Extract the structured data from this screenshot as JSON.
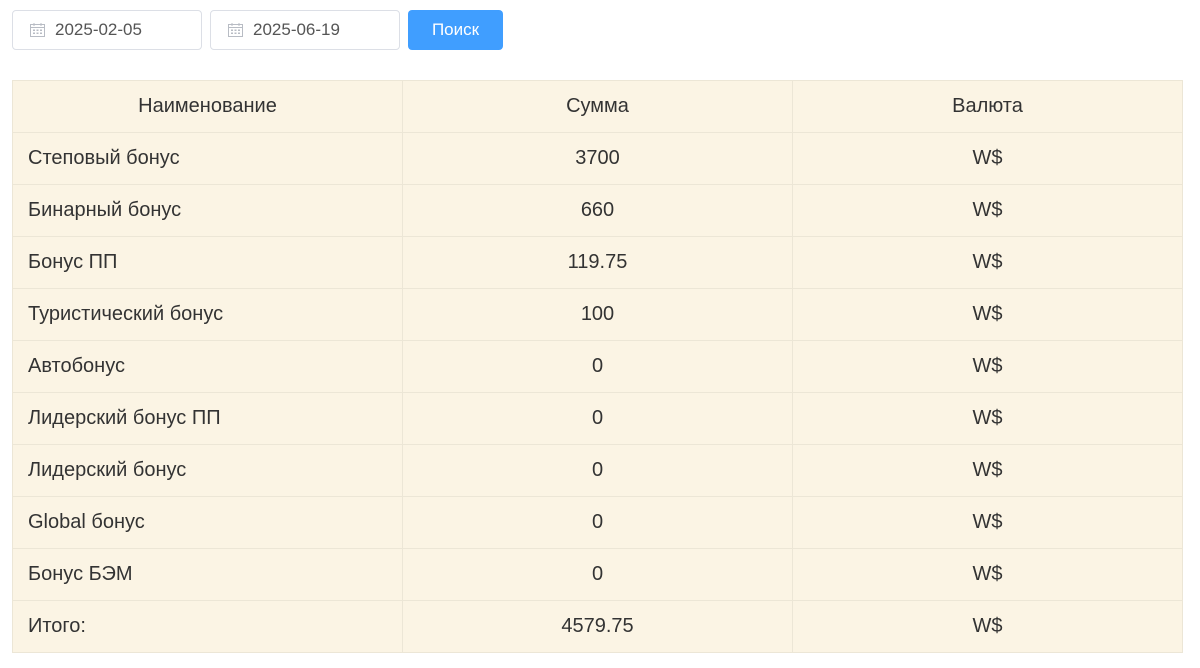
{
  "filters": {
    "date_from": "2025-02-05",
    "date_to": "2025-06-19",
    "date_icon": "calendar-icon",
    "search_label": "Поиск"
  },
  "colors": {
    "accent": "#409eff",
    "table_bg": "#fbf4e4",
    "border": "#ece6d6"
  },
  "table": {
    "headers": {
      "name": "Наименование",
      "amount": "Сумма",
      "currency": "Валюта"
    },
    "rows": [
      {
        "name": "Степовый бонус",
        "amount": "3700",
        "currency": "W$"
      },
      {
        "name": "Бинарный бонус",
        "amount": "660",
        "currency": "W$"
      },
      {
        "name": "Бонус ПП",
        "amount": "119.75",
        "currency": "W$"
      },
      {
        "name": "Туристический бонус",
        "amount": "100",
        "currency": "W$"
      },
      {
        "name": "Автобонус",
        "amount": "0",
        "currency": "W$"
      },
      {
        "name": "Лидерский бонус ПП",
        "amount": "0",
        "currency": "W$"
      },
      {
        "name": "Лидерский бонус",
        "amount": "0",
        "currency": "W$"
      },
      {
        "name": "Global бонус",
        "amount": "0",
        "currency": "W$"
      },
      {
        "name": "Бонус БЭМ",
        "amount": "0",
        "currency": "W$"
      }
    ],
    "total": {
      "name": "Итого:",
      "amount": "4579.75",
      "currency": "W$"
    }
  }
}
